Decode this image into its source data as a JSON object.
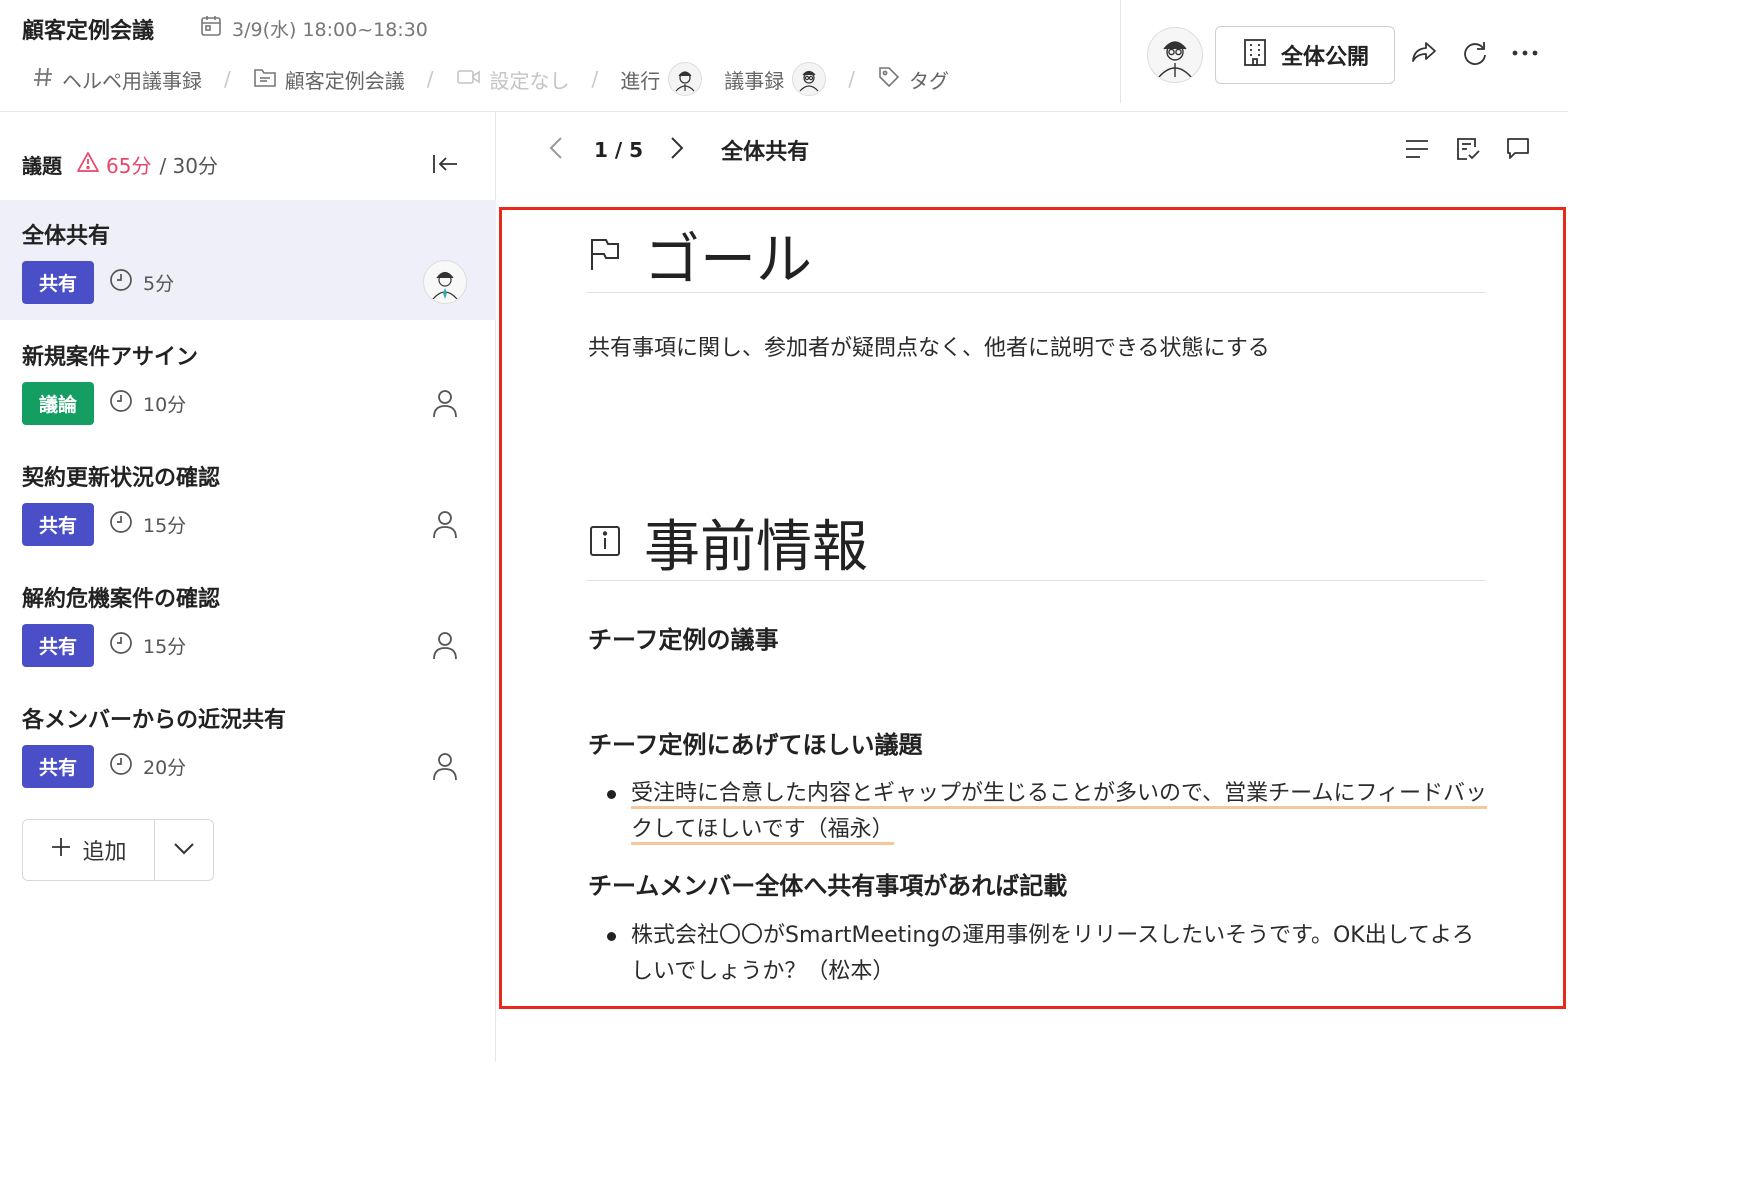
{
  "header": {
    "title": "顧客定例会議",
    "datetime": "3/9(水) 18:00~18:30",
    "meta": {
      "channel": "ヘルペ用議事録",
      "folder": "顧客定例会議",
      "video": "設定なし",
      "facilitator_label": "進行",
      "minutes_label": "議事録",
      "tag_label": "タグ"
    },
    "public_button": "全体公開"
  },
  "sidebar": {
    "label": "議題",
    "total_time": "65分",
    "planned_time": "/ 30分",
    "items": [
      {
        "title": "全体共有",
        "tag": "共有",
        "tag_type": "share",
        "duration": "5分",
        "assignee": "photo",
        "active": true
      },
      {
        "title": "新規案件アサイン",
        "tag": "議論",
        "tag_type": "discuss",
        "duration": "10分",
        "assignee": "none",
        "active": false
      },
      {
        "title": "契約更新状況の確認",
        "tag": "共有",
        "tag_type": "share",
        "duration": "15分",
        "assignee": "none",
        "active": false
      },
      {
        "title": "解約危機案件の確認",
        "tag": "共有",
        "tag_type": "share",
        "duration": "15分",
        "assignee": "none",
        "active": false
      },
      {
        "title": "各メンバーからの近況共有",
        "tag": "共有",
        "tag_type": "share",
        "duration": "20分",
        "assignee": "none",
        "active": false
      }
    ],
    "add_button": "追加"
  },
  "main": {
    "pager": {
      "count": "1 / 5",
      "topic": "全体共有"
    },
    "goal": {
      "heading": "ゴール",
      "text": "共有事項に関し、参加者が疑問点なく、他者に説明できる状態にする"
    },
    "pre_info": {
      "heading": "事前情報",
      "sub1": "チーフ定例の議事",
      "sub2": "チーフ定例にあげてほしい議題",
      "bullet1": "受注時に合意した内容とギャップが生じることが多いので、営業チームにフィードバックしてほしいです（福永）",
      "sub3": "チームメンバー全体へ共有事項があれば記載",
      "bullet2": "株式会社〇〇がSmartMeetingの運用事例をリリースしたいそうです。OK出してよろしいでしょうか？（松本）"
    }
  },
  "colors": {
    "share_tag": "#4a4fc7",
    "discuss_tag": "#159e62",
    "warning": "#e8476b",
    "highlight_frame": "#e8291c",
    "underline": "#f6c79b",
    "active_row": "#eeeff8"
  }
}
